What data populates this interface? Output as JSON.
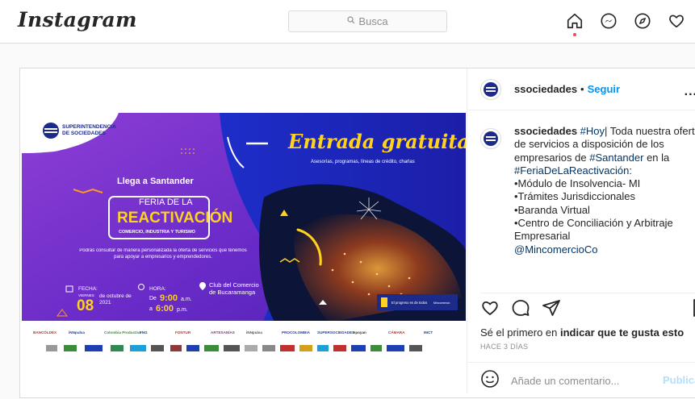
{
  "nav": {
    "logo": "Instagram",
    "search_placeholder": "Busca",
    "icons": [
      "home-icon",
      "messenger-icon",
      "explore-icon",
      "heart-icon"
    ]
  },
  "post": {
    "username": "ssociedades",
    "separator": "•",
    "follow_label": "Seguir",
    "more_label": "...",
    "caption": {
      "user": "ssociedades",
      "lines": [
        {
          "pre": "",
          "tag": "#Hoy",
          "post": "| Toda nuestra oferta"
        },
        {
          "pre": "de servicios a disposición de los",
          "tag": "",
          "post": ""
        },
        {
          "pre": "empresarios de ",
          "tag": "#Santander",
          "post": " en la"
        },
        {
          "pre": "",
          "tag": "#FeriaDeLaReactivación",
          "post": ":"
        },
        {
          "pre": "•Módulo de Insolvencia- MI",
          "tag": "",
          "post": ""
        },
        {
          "pre": "•Trámites Jurisdiccionales",
          "tag": "",
          "post": ""
        },
        {
          "pre": "•Baranda Virtual",
          "tag": "",
          "post": ""
        },
        {
          "pre": "•Centro de Conciliación y Arbitraje",
          "tag": "",
          "post": ""
        },
        {
          "pre": "Empresarial",
          "tag": "",
          "post": ""
        },
        {
          "pre": "",
          "tag": "@MincomercioCo",
          "post": ""
        }
      ]
    },
    "likes_text_pre": "Sé el primero en ",
    "likes_text_bold": "indicar que te gusta esto",
    "timestamp": "HACE 3 DÍAS",
    "comment_placeholder": "Añade un comentario...",
    "publish_label": "Publicar"
  },
  "banner": {
    "brand_line1": "SUPERINTENDENCIA",
    "brand_line2": "DE SOCIEDADES",
    "headline": "Entrada gratuita",
    "subhead": "Asesorías, programas, líneas de crédito, charlas",
    "arrives": "Llega a Santander",
    "feria_line1": "FERIA DE LA",
    "feria_line2": "REACTIVACIÓN",
    "feria_line3": "COMERCIO, INDUSTRIA Y TURISMO",
    "blurb": "Podrás consultar de manera personalizada la oferta de servicios que tenemos para apoyar a empresarios y emprendedores.",
    "fecha_label": "FECHA:",
    "fecha_day": "VIERNES",
    "fecha_num": "08",
    "fecha_month": "de octubre de 2021",
    "hora_label": "HORA:",
    "hora_de": "De",
    "hora_start": "9:00",
    "hora_am": "a.m.",
    "hora_a": "a",
    "hora_end": "6:00",
    "hora_pm": "p.m.",
    "lugar": "Club del Comercio de Bucaramanga",
    "gov_label": "El progreso es de todos",
    "ministry": "Mincomercio",
    "sponsors_row1": [
      "BANCÓLDEX",
      "iNNpulsa",
      "Colombia Productiva",
      "FNG",
      "FONTUR",
      "ARTESANÍAS",
      "iNNpulsa",
      "PROCOLOMBIA",
      "SUPERSOCIEDADES",
      "Apoyan",
      "CÁMARA",
      "IMCT"
    ],
    "colors": {
      "purple": "#6a2bc8",
      "blue": "#1d2ec9",
      "yellow": "#ffd21f",
      "orange": "#ff9a1f"
    }
  }
}
